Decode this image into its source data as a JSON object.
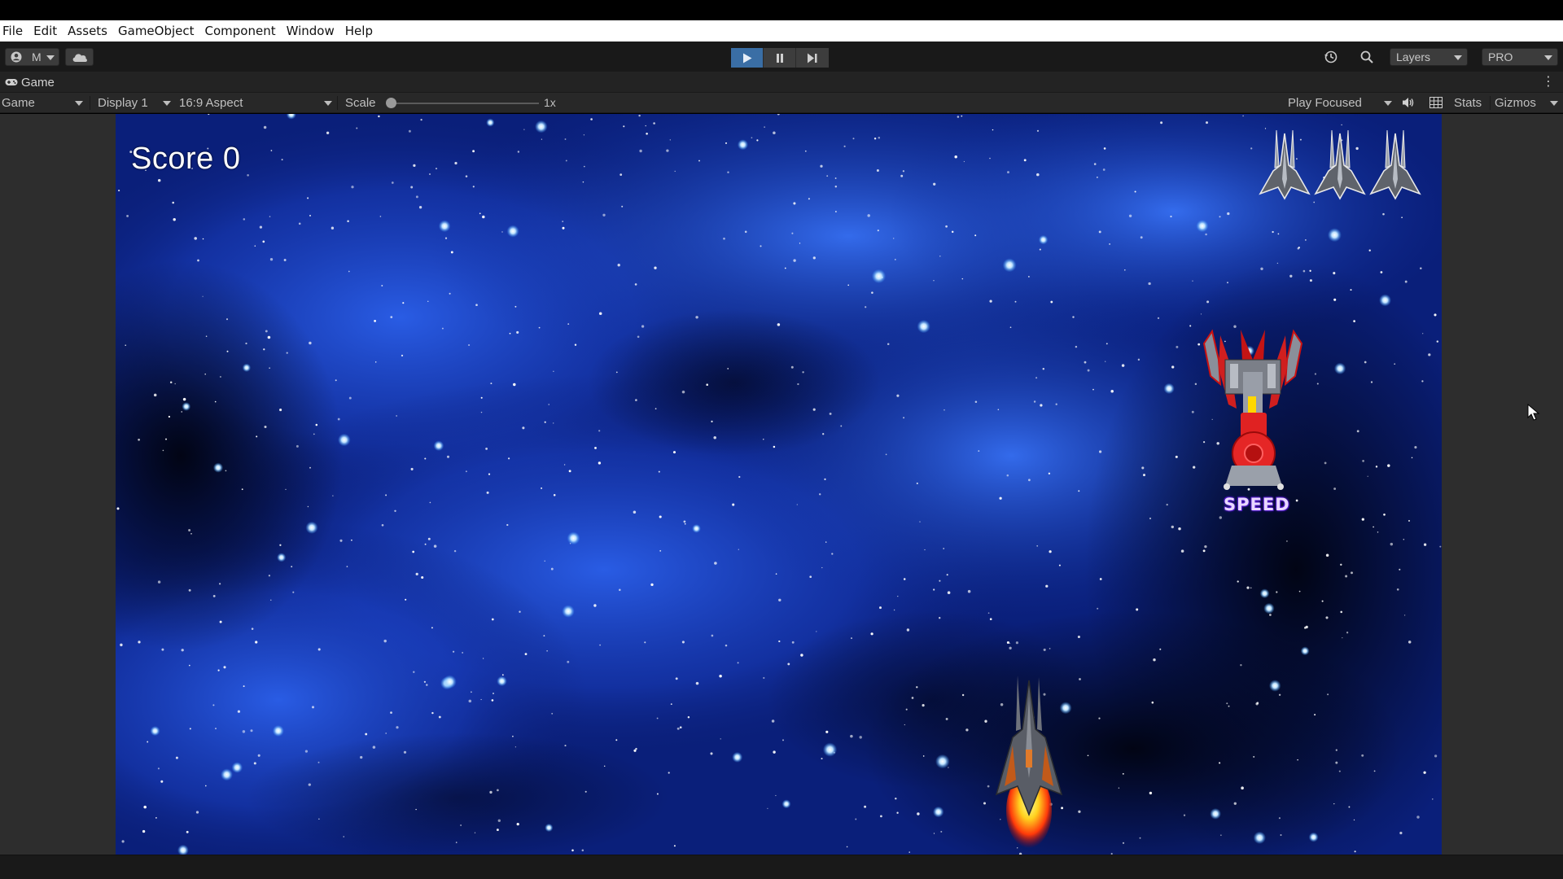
{
  "menu": {
    "items": [
      "File",
      "Edit",
      "Assets",
      "GameObject",
      "Component",
      "Window",
      "Help"
    ]
  },
  "toolbar": {
    "account_label": "M",
    "account_icon": "account-icon",
    "cloud_icon": "cloud-icon",
    "play_icon": "play-icon",
    "pause_icon": "pause-icon",
    "step_icon": "step-icon",
    "history_icon": "history-icon",
    "search_icon": "search-icon",
    "layers_label": "Layers",
    "layout_label": "PRO",
    "play_active_color": "#3a6ea5"
  },
  "tab": {
    "label": "Game",
    "icon": "gamepad-icon"
  },
  "game_view": {
    "view_select": "Game",
    "display_select": "Display 1",
    "aspect_select": "16:9 Aspect",
    "scale_label": "Scale",
    "scale_value": "1x",
    "scale_level": 0.0,
    "play_mode_select": "Play Focused",
    "audio_icon": "speaker-icon",
    "grid_icon": "stats-grid-icon",
    "stats_label": "Stats",
    "gizmos_label": "Gizmos"
  },
  "game": {
    "score_text": "Score 0",
    "lives": 3,
    "powerup_label": "SPEED",
    "background_color": "#0a1f7a",
    "nebula_color": "#1f4fd9"
  }
}
